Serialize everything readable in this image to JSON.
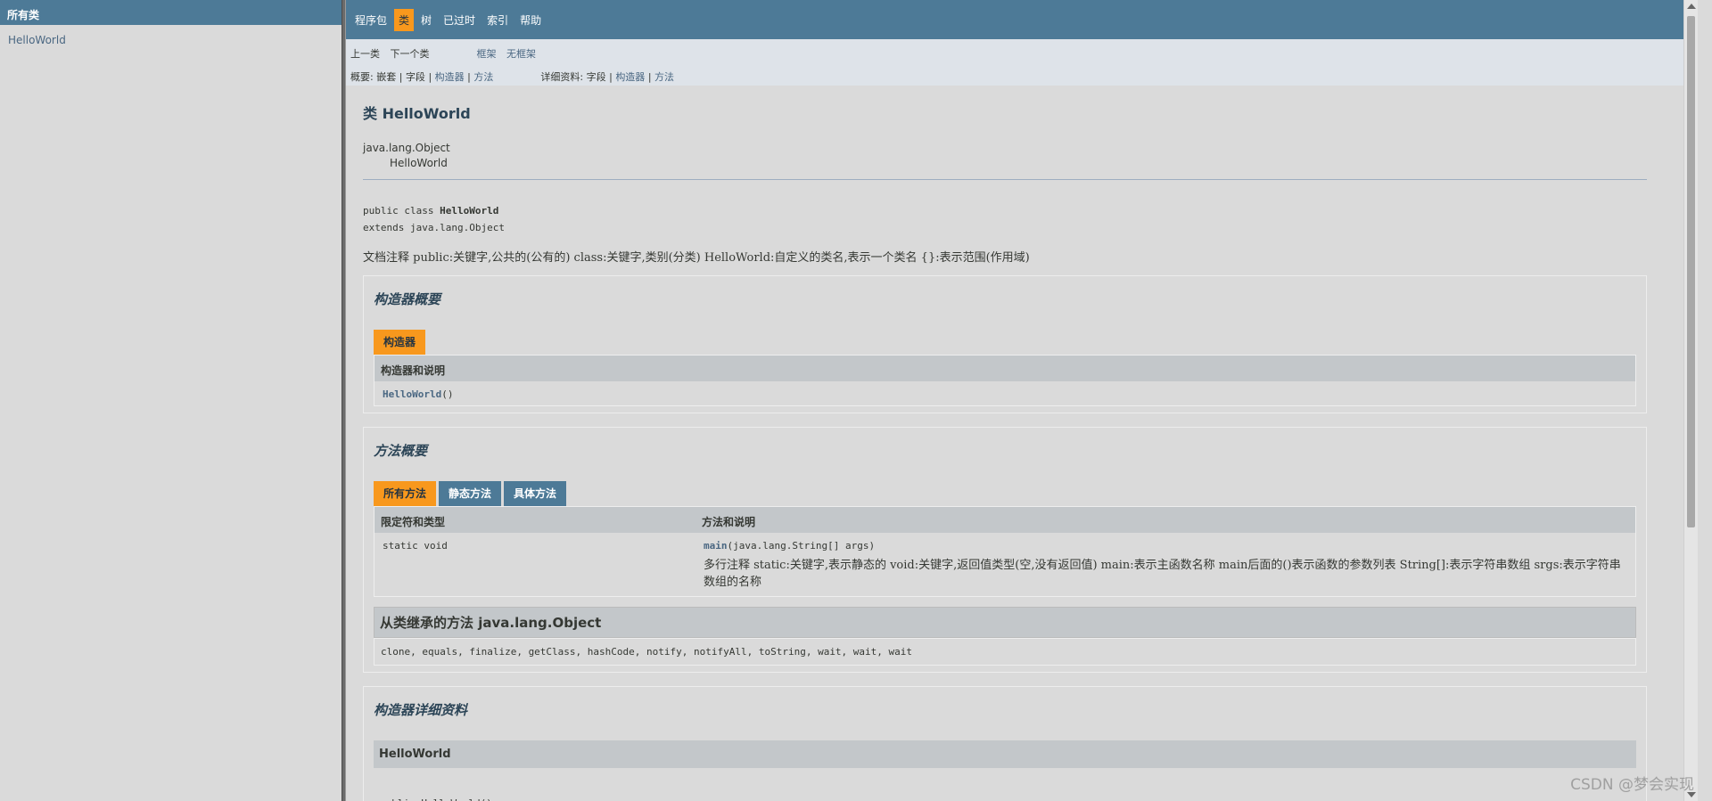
{
  "left": {
    "header": "所有类",
    "classes": [
      "HelloWorld"
    ]
  },
  "topnav": {
    "items": [
      "程序包",
      "类",
      "树",
      "已过时",
      "索引",
      "帮助"
    ],
    "active_index": 1
  },
  "subnav": {
    "prev": "上一类",
    "next": "下一个类",
    "frames": "框架",
    "noframes": "无框架",
    "summary_label": "概要:",
    "summary_nested": "嵌套",
    "summary_field": "字段",
    "summary_constructor": "构造器",
    "summary_method": "方法",
    "detail_label": "详细资料:",
    "detail_field": "字段",
    "detail_constructor": "构造器",
    "detail_method": "方法",
    "sep": "|"
  },
  "content": {
    "title": "类 HelloWorld",
    "inherit_root": "java.lang.Object",
    "inherit_child": "HelloWorld",
    "sig_prefix": "public class ",
    "sig_name": "HelloWorld",
    "sig_extends": "extends java.lang.Object",
    "doc": "文档注释 public:关键字,公共的(公有的) class:关键字,类别(分类) HelloWorld:自定义的类名,表示一个类名 {}:表示范围(作用域)"
  },
  "ctor_summary": {
    "heading": "构造器概要",
    "tab": "构造器",
    "col": "构造器和说明",
    "name": "HelloWorld",
    "parens": "()"
  },
  "method_summary": {
    "heading": "方法概要",
    "tabs": [
      "所有方法",
      "静态方法",
      "具体方法"
    ],
    "col1": "限定符和类型",
    "col2": "方法和说明",
    "modifier": "static void",
    "method_name": "main",
    "method_params": "(java.lang.String[]  args)",
    "description": "多行注释 static:关键字,表示静态的 void:关键字,返回值类型(空,没有返回值) main:表示主函数名称 main后面的()表示函数的参数列表 String[]:表示字符串数组 srgs:表示字符串数组的名称",
    "inherited_head": "从类继承的方法 java.lang.Object",
    "inherited_list": "clone, equals, finalize, getClass, hashCode, notify, notifyAll, toString, wait, wait, wait"
  },
  "ctor_detail": {
    "heading": "构造器详细资料",
    "name": "HelloWorld",
    "sig": "public HelloWorld()"
  },
  "watermark": "CSDN @梦会实现"
}
